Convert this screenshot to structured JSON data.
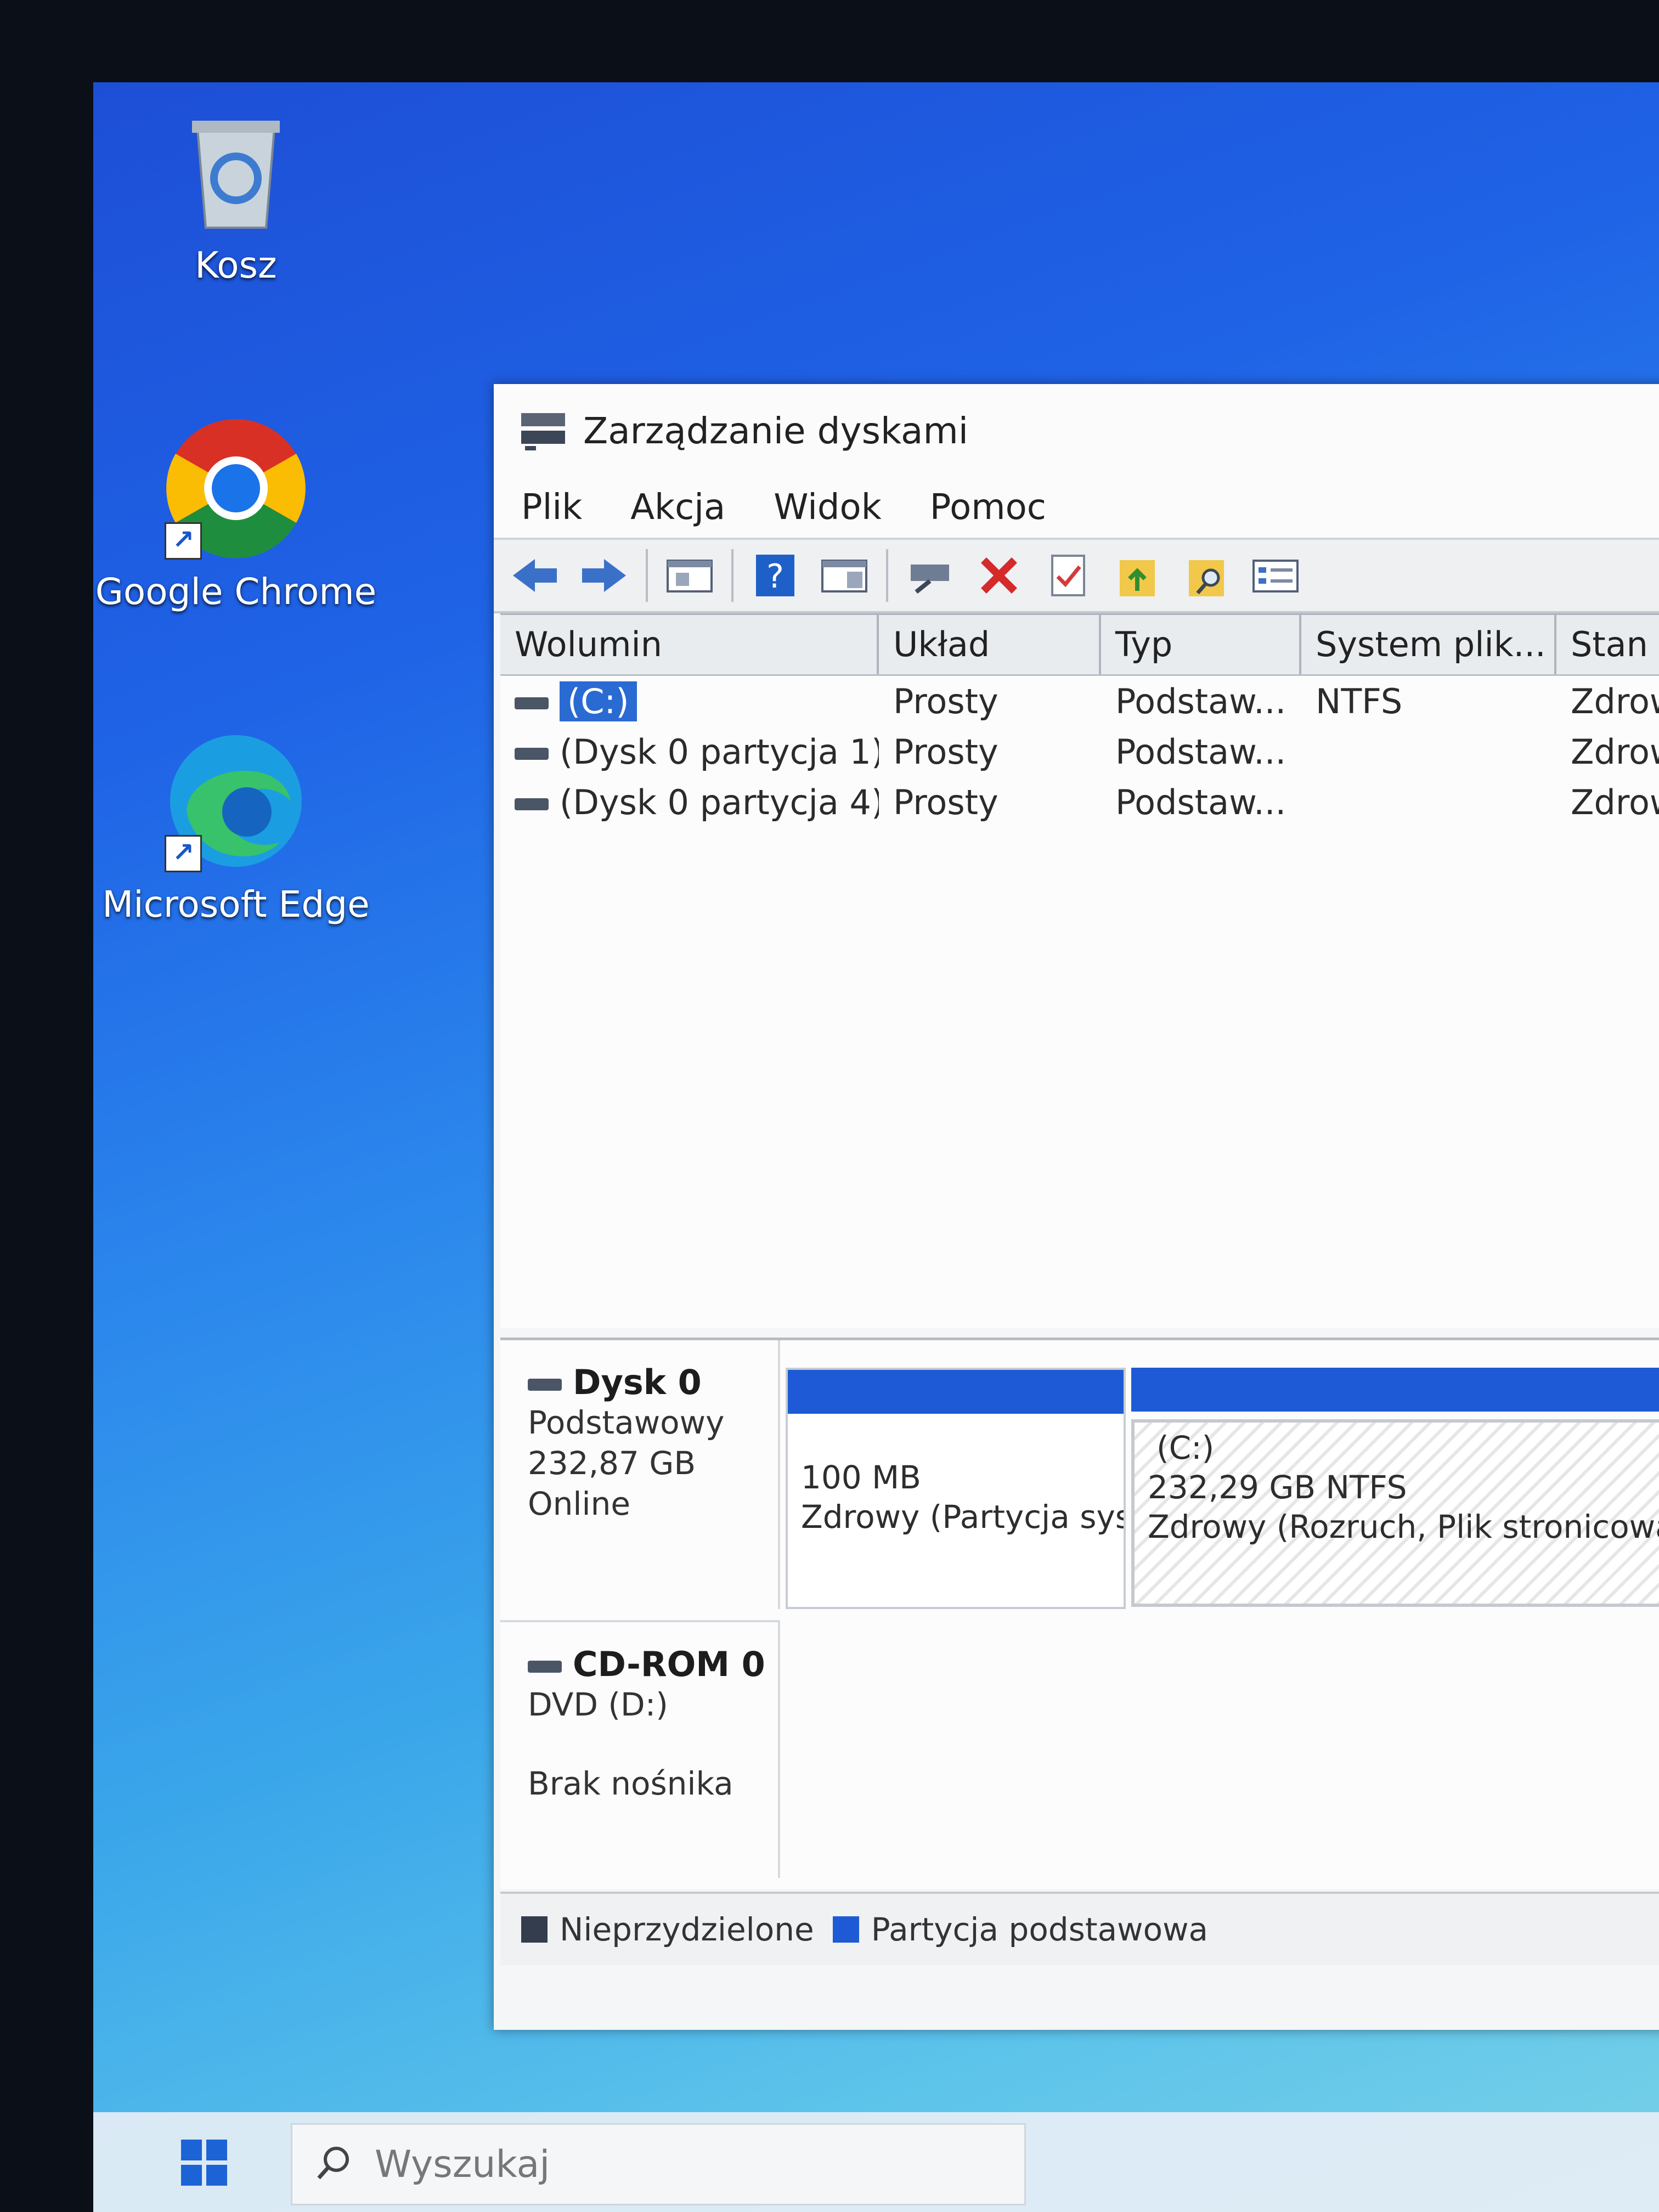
{
  "desktop": {
    "icons": [
      {
        "label": "Kosz"
      },
      {
        "label": "Google Chrome"
      },
      {
        "label": "Microsoft Edge"
      }
    ]
  },
  "window": {
    "title": "Zarządzanie dyskami",
    "menu": [
      "Plik",
      "Akcja",
      "Widok",
      "Pomoc"
    ],
    "toolbar_icons": [
      "back-arrow-icon",
      "forward-arrow-icon",
      "properties-pane-icon",
      "help-icon",
      "action-pane-icon",
      "connect-icon",
      "delete-icon",
      "checklist-icon",
      "folder-up-icon",
      "folder-search-icon",
      "properties-icon"
    ]
  },
  "volume_list": {
    "columns": [
      "Wolumin",
      "Układ",
      "Typ",
      "System plik...",
      "Stan"
    ],
    "rows": [
      {
        "volume": "(C:)",
        "layout": "Prosty",
        "type": "Podstaw...",
        "fs": "NTFS",
        "status": "Zdrow"
      },
      {
        "volume": "(Dysk 0 partycja 1)",
        "layout": "Prosty",
        "type": "Podstaw...",
        "fs": "",
        "status": "Zdrow"
      },
      {
        "volume": "(Dysk 0 partycja 4)",
        "layout": "Prosty",
        "type": "Podstaw...",
        "fs": "",
        "status": "Zdrow"
      }
    ]
  },
  "disks": {
    "disk0": {
      "name": "Dysk 0",
      "type": "Podstawowy",
      "size": "232,87 GB",
      "state": "Online",
      "partitions": [
        {
          "line1": "",
          "line2": "100 MB",
          "line3": "Zdrowy (Partycja sys"
        },
        {
          "line1": "(C:)",
          "line2": "232,29 GB NTFS",
          "line3": "Zdrowy (Rozruch, Plik stronicowar"
        }
      ]
    },
    "cdrom0": {
      "name": "CD-ROM 0",
      "drive": "DVD (D:)",
      "media": "Brak nośnika"
    }
  },
  "legend": [
    {
      "label": "Nieprzydzielone",
      "color": "#333d4d"
    },
    {
      "label": "Partycja podstawowa",
      "color": "#1e5ad6"
    }
  ],
  "taskbar": {
    "search_placeholder": "Wyszukaj"
  }
}
